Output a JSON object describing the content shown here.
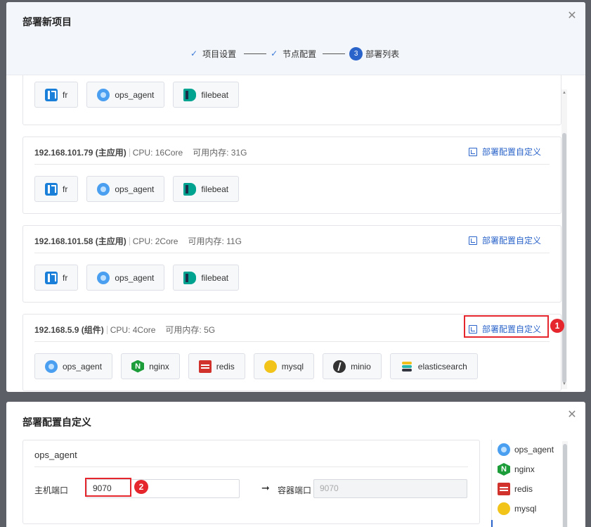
{
  "deploy_dialog": {
    "title": "部署新项目",
    "steps": [
      {
        "label": "项目设置",
        "state": "done"
      },
      {
        "label": "节点配置",
        "state": "done"
      },
      {
        "number": "3",
        "label": "部署列表",
        "state": "active"
      }
    ],
    "top_partial_card": {
      "components": [
        "fr",
        "ops_agent",
        "filebeat"
      ]
    },
    "nodes": [
      {
        "host": "192.168.101.79 (主应用)",
        "cpu": "CPU: 16Core",
        "mem": "可用内存: 31G",
        "link": "部署配置自定义",
        "components": [
          "fr",
          "ops_agent",
          "filebeat"
        ]
      },
      {
        "host": "192.168.101.58 (主应用)",
        "cpu": "CPU: 2Core",
        "mem": "可用内存: 11G",
        "link": "部署配置自定义",
        "components": [
          "fr",
          "ops_agent",
          "filebeat"
        ]
      },
      {
        "host": "192.168.5.9 (组件)",
        "cpu": "CPU: 4Core",
        "mem": "可用内存: 5G",
        "link": "部署配置自定义",
        "components": [
          "ops_agent",
          "nginx",
          "redis",
          "mysql",
          "minio",
          "elasticsearch"
        ]
      }
    ]
  },
  "custom_dialog": {
    "title": "部署配置自定义",
    "card_title": "ops_agent",
    "host_port_label": "主机端口",
    "host_port_value": "9070",
    "container_port_label": "容器端口",
    "container_port_placeholder": "9070",
    "side_list": [
      "ops_agent",
      "nginx",
      "redis",
      "mysql"
    ]
  },
  "annotations": {
    "badge1": "1",
    "badge2": "2"
  },
  "icons": {
    "close": "close-icon",
    "check": "check-icon",
    "arrow": "arrow-right-icon",
    "custom": "expand-icon"
  },
  "colors": {
    "accent": "#2a63c9",
    "annotation": "#e5262d"
  }
}
